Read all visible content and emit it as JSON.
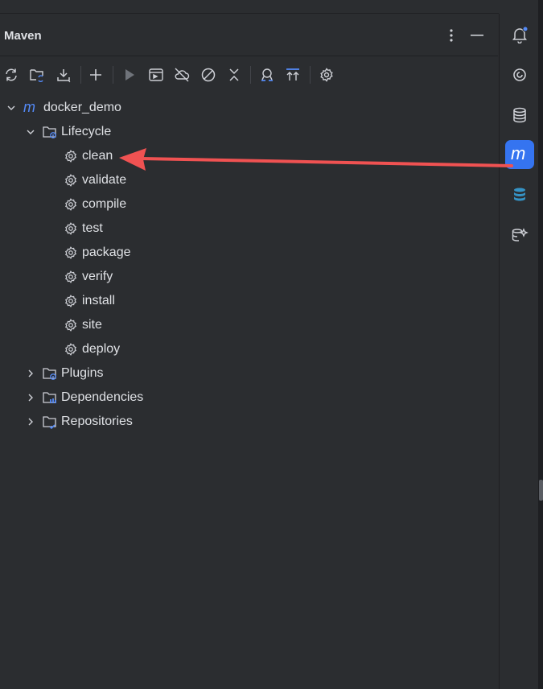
{
  "panel": {
    "title": "Maven"
  },
  "tree": {
    "root": {
      "label": "docker_demo"
    },
    "lifecycle": {
      "label": "Lifecycle",
      "items": [
        {
          "label": "clean"
        },
        {
          "label": "validate"
        },
        {
          "label": "compile"
        },
        {
          "label": "test"
        },
        {
          "label": "package"
        },
        {
          "label": "verify"
        },
        {
          "label": "install"
        },
        {
          "label": "site"
        },
        {
          "label": "deploy"
        }
      ]
    },
    "plugins": {
      "label": "Plugins"
    },
    "dependencies": {
      "label": "Dependencies"
    },
    "repositories": {
      "label": "Repositories"
    }
  },
  "toolbar": {
    "icons": [
      "reload-icon",
      "generate-sources-icon",
      "download-icon",
      "add-icon",
      "run-icon",
      "execute-goal-icon",
      "offline-icon",
      "skip-tests-icon",
      "collapse-icon",
      "show-dependencies-icon",
      "expand-all-icon",
      "settings-icon"
    ]
  },
  "rightbar": {
    "icons": [
      "notifications-icon",
      "ai-assistant-icon",
      "database-icon",
      "maven-icon",
      "db-tool-icon",
      "ai-sql-icon"
    ],
    "active": "maven-icon"
  },
  "colors": {
    "background": "#2b2d30",
    "border": "#1e1f22",
    "text": "#dfe1e5",
    "icon": "#ced0d6",
    "accent": "#3574f0",
    "maven_logo": "#548af7",
    "annotation_arrow": "#f05252"
  }
}
